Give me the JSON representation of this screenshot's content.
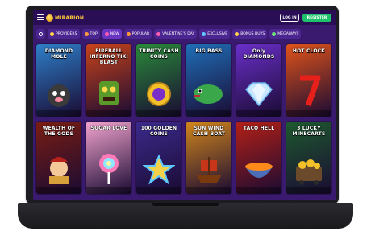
{
  "header": {
    "logo_text": "MIRARION",
    "login_label": "LOG IN",
    "register_label": "REGISTER"
  },
  "nav": {
    "items": [
      {
        "label": "",
        "icon": "search-icon"
      },
      {
        "label": "PROVIDERS",
        "icon": "providers-icon"
      },
      {
        "label": "TOP",
        "icon": "top-icon"
      },
      {
        "label": "NEW",
        "icon": "new-icon",
        "active": true
      },
      {
        "label": "POPULAR",
        "icon": "popular-icon"
      },
      {
        "label": "VALENTINE'S DAY",
        "icon": "heart-icon"
      },
      {
        "label": "EXCLUSIVE",
        "icon": "exclusive-icon"
      },
      {
        "label": "BONUS BUYS",
        "icon": "bonus-icon"
      },
      {
        "label": "MEGAWAYS",
        "icon": "megaways-icon"
      }
    ]
  },
  "games": [
    {
      "title": "DIAMOND MOLE",
      "bg": "#2e7fc9"
    },
    {
      "title": "FIREBALL INFERNO TIKI BLAST",
      "bg": "#c8431b"
    },
    {
      "title": "TRINITY CASH COINS",
      "bg": "#2a8a3a"
    },
    {
      "title": "BIG BASS",
      "bg": "#1f6fb8"
    },
    {
      "title": "Only DIAMONDS",
      "bg": "#6a2fc9"
    },
    {
      "title": "HOT CLOCK",
      "bg": "#e0531a"
    },
    {
      "title": "WEALTH OF THE GODS",
      "bg": "#7a1d12"
    },
    {
      "title": "SUGAR LOVE",
      "bg": "#f2a4cf"
    },
    {
      "title": "100 GOLDEN COINS",
      "bg": "#3b2a8c"
    },
    {
      "title": "SUN WIND CASH BOAT",
      "bg": "#d2861c"
    },
    {
      "title": "TACO HELL",
      "bg": "#b42016"
    },
    {
      "title": "3 LUCKY MINECARTS",
      "bg": "#1d5a2e"
    }
  ]
}
